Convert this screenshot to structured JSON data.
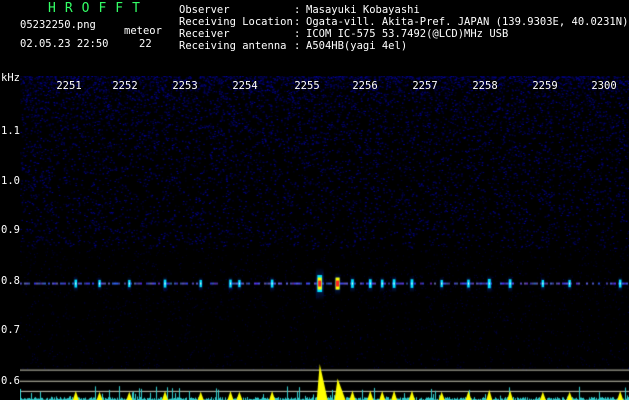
{
  "header": {
    "app_title": "HROFFT",
    "filename": "05232250.png",
    "datetime": "02.05.23 22:50",
    "meteor_label": "meteor",
    "meteor_count": "22",
    "fields": [
      {
        "label": "Observer",
        "colon": ":",
        "value": "Masayuki Kobayashi"
      },
      {
        "label": "Receiving Location",
        "colon": ":",
        "value": "Ogata-vill. Akita-Pref. JAPAN (139.9303E, 40.0231N)"
      },
      {
        "label": "Receiver",
        "colon": ":",
        "value": "ICOM IC-575 53.7492(@LCD)MHz USB"
      },
      {
        "label": "Receiving antenna",
        "colon": ":",
        "value": "A504HB(yagi 4el)"
      }
    ]
  },
  "chart_data": {
    "type": "heatmap",
    "ylabel": "kHz",
    "x_ticks": [
      "2251",
      "2252",
      "2253",
      "2254",
      "2255",
      "2256",
      "2257",
      "2258",
      "2259",
      "2300"
    ],
    "y_ticks": [
      "1.1",
      "1.0",
      "0.9",
      "0.8",
      "0.7",
      "0.6"
    ],
    "x_range": [
      "22:50",
      "23:00"
    ],
    "y_range_khz": [
      0.56,
      1.2
    ],
    "carrier_khz": 0.79,
    "grid": false,
    "colormap": [
      "#000000",
      "#000060",
      "#0000ff",
      "#00ffff",
      "#ffff00",
      "#ff0000"
    ],
    "echoes": [
      {
        "t_min": 0.45,
        "strength": 0.35
      },
      {
        "t_min": 0.85,
        "strength": 0.3
      },
      {
        "t_min": 1.35,
        "strength": 0.3
      },
      {
        "t_min": 1.95,
        "strength": 0.35
      },
      {
        "t_min": 2.55,
        "strength": 0.3
      },
      {
        "t_min": 3.05,
        "strength": 0.35
      },
      {
        "t_min": 3.2,
        "strength": 0.3
      },
      {
        "t_min": 3.75,
        "strength": 0.35
      },
      {
        "t_min": 4.55,
        "strength": 1.0
      },
      {
        "t_min": 4.85,
        "strength": 0.6
      },
      {
        "t_min": 5.1,
        "strength": 0.4
      },
      {
        "t_min": 5.4,
        "strength": 0.4
      },
      {
        "t_min": 5.6,
        "strength": 0.35
      },
      {
        "t_min": 5.8,
        "strength": 0.4
      },
      {
        "t_min": 6.1,
        "strength": 0.4
      },
      {
        "t_min": 6.6,
        "strength": 0.3
      },
      {
        "t_min": 7.05,
        "strength": 0.35
      },
      {
        "t_min": 7.4,
        "strength": 0.45
      },
      {
        "t_min": 7.75,
        "strength": 0.4
      },
      {
        "t_min": 8.3,
        "strength": 0.3
      },
      {
        "t_min": 8.75,
        "strength": 0.3
      },
      {
        "t_min": 9.6,
        "strength": 0.35
      }
    ],
    "amplitude_colors": {
      "signal": "#ffff00",
      "noise": "#33cccc",
      "reference_lines": "#c8c8b4"
    }
  }
}
